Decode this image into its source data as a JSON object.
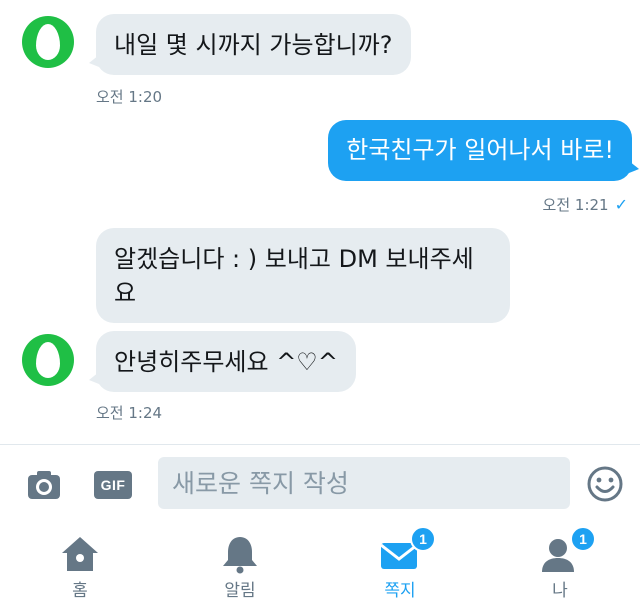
{
  "messages": [
    {
      "direction": "in",
      "text": "내일 몇 시까지 가능합니까?"
    },
    {
      "direction": "out",
      "text": "한국친구가 일어나서 바로!"
    },
    {
      "direction": "in",
      "text": "알겠습니다 : ) 보내고 DM 보내주세요"
    },
    {
      "direction": "in",
      "text": "안녕히주무세요 ^♡^"
    }
  ],
  "timestamps": {
    "t1": "오전 1:20",
    "t2": "오전 1:21",
    "t2_read": "✓",
    "t3": "오전 1:24"
  },
  "composer": {
    "placeholder": "새로운 쪽지 작성",
    "gif_label": "GIF"
  },
  "tabs": [
    {
      "label": "홈",
      "icon": "home-icon",
      "badge": ""
    },
    {
      "label": "알림",
      "icon": "bell-icon",
      "badge": ""
    },
    {
      "label": "쪽지",
      "icon": "envelope-icon",
      "badge": "1",
      "active": true
    },
    {
      "label": "나",
      "icon": "person-icon",
      "badge": "1"
    }
  ],
  "colors": {
    "accent": "#1da1f2",
    "incoming_bubble": "#e6ecf0",
    "avatar": "#1fbf45",
    "muted": "#657786"
  }
}
